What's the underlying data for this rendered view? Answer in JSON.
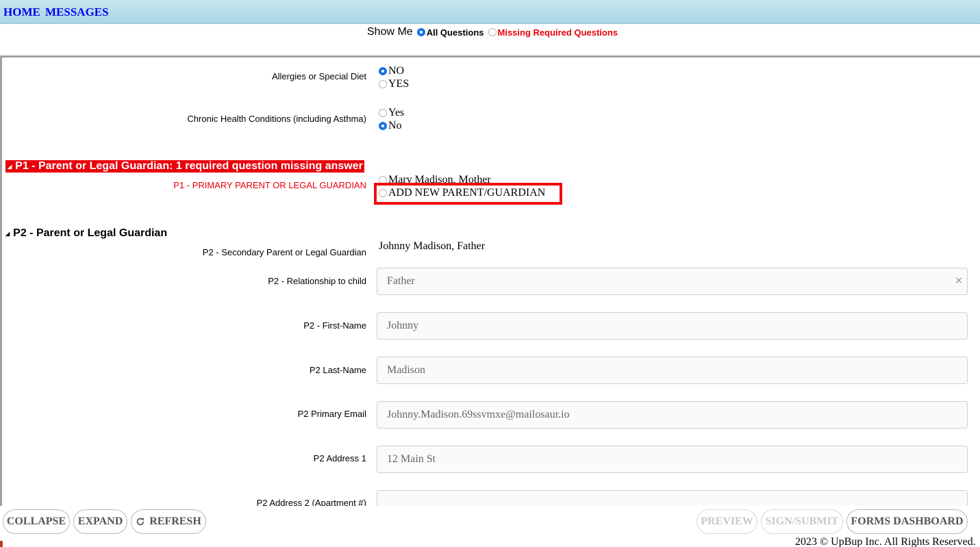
{
  "nav": {
    "home": "HOME",
    "messages": "MESSAGES"
  },
  "showme": {
    "label": "Show Me",
    "all": "All Questions",
    "missing": "Missing Required Questions",
    "selected": "All Questions"
  },
  "questions": {
    "allergies": {
      "label": "Allergies or Special Diet",
      "options": [
        "NO",
        "YES"
      ],
      "selected": "NO"
    },
    "chronic": {
      "label": "Chronic Health Conditions (including Asthma)",
      "options": [
        "Yes",
        "No"
      ],
      "selected": "No"
    }
  },
  "p1": {
    "heading": "P1 - Parent or Legal Guardian: 1 required question missing answer",
    "label": "P1 - PRIMARY PARENT OR LEGAL GUARDIAN",
    "options": [
      "Mary Madison, Mother",
      "ADD NEW PARENT/GUARDIAN"
    ]
  },
  "p2": {
    "heading": "P2 - Parent or Legal Guardian",
    "secondary_label": "P2 - Secondary Parent or Legal Guardian",
    "secondary_value": "Johnny Madison, Father",
    "fields": [
      {
        "label": "P2 - Relationship to child",
        "value": "Father",
        "clear": "×"
      },
      {
        "label": "P2 - First-Name",
        "value": "Johnny"
      },
      {
        "label": "P2 Last-Name",
        "value": "Madison"
      },
      {
        "label": "P2 Primary Email",
        "value": "Johnny.Madison.69ssvmxe@mailosaur.io"
      },
      {
        "label": "P2 Address 1",
        "value": "12 Main St"
      },
      {
        "label": "P2 Address 2 (Apartment #)",
        "value": ""
      }
    ]
  },
  "toolbar": {
    "collapse": "COLLAPSE",
    "expand": "EXPAND",
    "refresh": "REFRESH",
    "preview": "PREVIEW",
    "sign_submit": "SIGN/SUBMIT",
    "forms_dashboard": "FORMS DASHBOARD"
  },
  "footer": {
    "copyright": "2023 © UpBup Inc. All Rights Reserved."
  },
  "colors": {
    "accent_blue": "#1a73e8",
    "missing_red": "#e8000b",
    "nav_bg": "#b7dde9"
  }
}
